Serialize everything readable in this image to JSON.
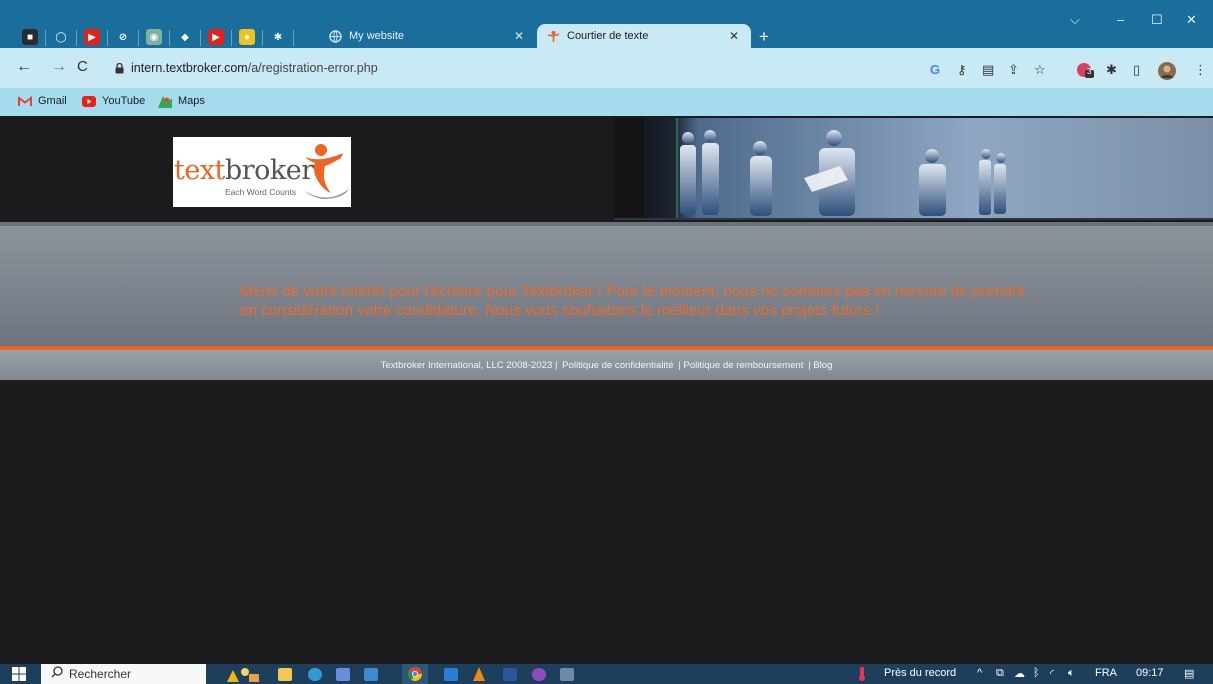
{
  "browser": {
    "pinned_tabs": [
      {
        "icon": "dark-app-icon",
        "color": "#2b2b2b",
        "glyph": "■"
      },
      {
        "icon": "github-icon",
        "color": "#1a6e9c",
        "glyph": "◯"
      },
      {
        "icon": "youtube-icon",
        "color": "#e62117",
        "glyph": "▶"
      },
      {
        "icon": "link-icon",
        "color": "#1a6e9c",
        "glyph": "⊘"
      },
      {
        "icon": "chatgpt-icon",
        "color": "#7fb0a0",
        "glyph": "◉"
      },
      {
        "icon": "blue-app-icon",
        "color": "#1a6e9c",
        "glyph": "◆"
      },
      {
        "icon": "youtube-studio-icon",
        "color": "#e62117",
        "glyph": "▶"
      },
      {
        "icon": "yellow-app-icon",
        "color": "#f1c21b",
        "glyph": "●"
      },
      {
        "icon": "asterisk-icon",
        "color": "#1a6e9c",
        "glyph": "✱"
      }
    ],
    "tabs": [
      {
        "title": "My website",
        "active": false
      },
      {
        "title": "Courtier de texte",
        "active": true
      }
    ],
    "url_host": "intern.textbroker.com",
    "url_path": "/a/registration-error.php",
    "bookmarks": [
      {
        "label": "Gmail",
        "color": "#e94235"
      },
      {
        "label": "YouTube",
        "color": "#e62117"
      },
      {
        "label": "Maps",
        "color": "#34a853"
      }
    ],
    "extension_badge": "3"
  },
  "site": {
    "logo_word_a": "text",
    "logo_word_b": "broker",
    "logo_tagline": "Each Word Counts",
    "message": "Merci de votre intérêt pour l'écriture pour Textbroker ! Pour le moment, nous ne sommes pas en mesure de prendre en considération votre candidature. Nous vous souhaitons le meilleur dans vos projets futurs !",
    "footer_items": [
      "Textbroker International, LLC 2008-2023 |",
      "Politique de confidentialité",
      "| Politique de remboursement",
      "| Blog"
    ],
    "accent_color": "#e8641f"
  },
  "taskbar": {
    "search_placeholder": "Rechercher",
    "weather_label": "Près du record",
    "language": "FRA",
    "time": "09:17"
  }
}
